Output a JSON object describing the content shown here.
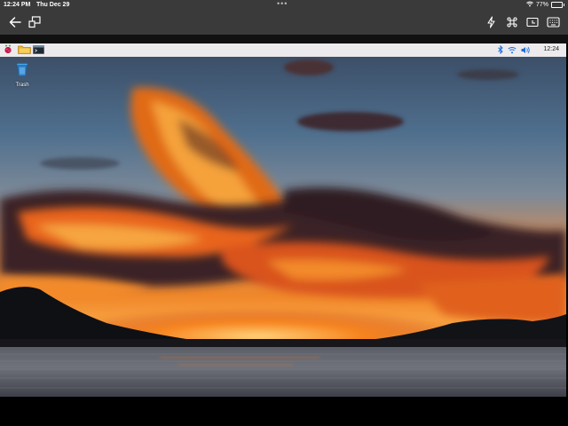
{
  "status_bar": {
    "time": "12:24 PM",
    "date": "Thu Dec 29",
    "more_dots": "•••",
    "battery_percent": "77%",
    "battery_level": 0.77
  },
  "toolbar": {
    "icons": [
      "back-arrow-icon",
      "screens-icon",
      "lightning-icon",
      "command-key-icon",
      "screenshot-icon",
      "keyboard-icon"
    ]
  },
  "desktop": {
    "panel": {
      "clock": "12:24",
      "icons": [
        "raspberry-menu-icon",
        "file-manager-icon",
        "terminal-icon",
        "bluetooth-icon",
        "wifi-icon",
        "volume-icon"
      ]
    },
    "trash_label": "Trash"
  },
  "colors": {
    "ios_bar": "#3a3a3a",
    "panel_bg": "#eceaed",
    "sky_top": "#3c4f68",
    "cloud_orange": "#f07a1c",
    "water": "#6a6e78"
  }
}
